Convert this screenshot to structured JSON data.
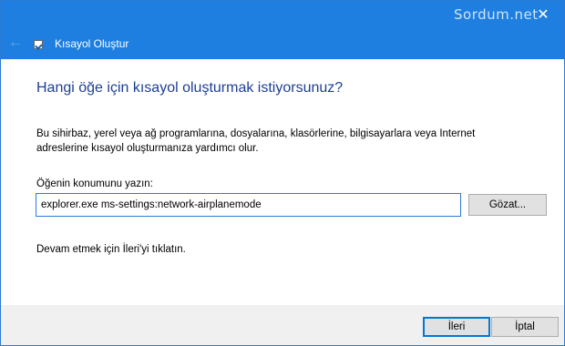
{
  "window": {
    "title": "Kısayol Oluştur",
    "watermark": "Sordum.net",
    "close_glyph": "✕",
    "back_glyph": "←"
  },
  "content": {
    "heading": "Hangi öğe için kısayol oluşturmak istiyorsunuz?",
    "description": "Bu sihirbaz, yerel veya ağ programlarına, dosyalarına, klasörlerine, bilgisayarlara veya Internet adreslerine kısayol oluşturmanıza yardımcı olur.",
    "location_label": "Öğenin konumunu yazın:",
    "location_value": "explorer.exe ms-settings:network-airplanemode",
    "browse_label": "Gözat...",
    "hint": "Devam etmek için İleri'yi tıklatın."
  },
  "footer": {
    "next_label": "İleri",
    "cancel_label": "İptal"
  },
  "colors": {
    "titlebar": "#1e7fe0",
    "heading": "#1c3f94",
    "input_border": "#2b7bd4"
  },
  "icons": {
    "app": "shortcut-icon",
    "back": "back-arrow-icon",
    "close": "close-icon"
  }
}
